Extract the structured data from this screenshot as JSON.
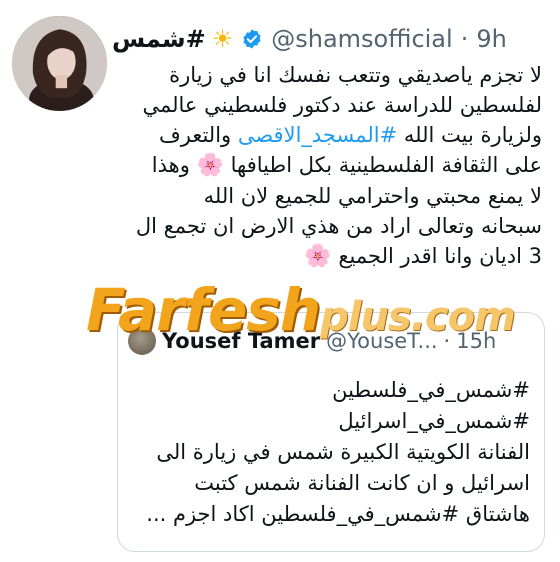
{
  "tweet": {
    "display_name": "#شمس",
    "name_emoji": "☀",
    "handle": "@shamsofficial",
    "separator": "·",
    "time": "9h",
    "lines": [
      "لا تجزم ياصديقي وتتعب نفسك انا في زيارة",
      "لفلسطين للدراسة عند دكتور فلسطيني عالمي",
      {
        "pre": "ولزيارة بيت الله ",
        "hashtag": "#المسجد_الاقصى",
        "post": " والتعرف"
      },
      {
        "pre": "على الثقافة الفلسطينية  بكل اطيافها ",
        "flower": "🌸",
        "post": " وهذا"
      },
      "لا يمنع محبتي واحترامي للجميع  لان الله",
      "سبحانه وتعالى اراد من هذي الارض ان تجمع ال",
      {
        "pre": "3 اديان وانا اقدر الجميع ",
        "flower": "🌸",
        "post": ""
      }
    ],
    "flower_color": "#e85d92",
    "link_color": "#1d9bf0"
  },
  "watermark": {
    "main": "Farfesh",
    "suffix": "plus.com",
    "color": "#f2a41c"
  },
  "quote": {
    "name": "Yousef Tamer",
    "handle": "@YouseT...",
    "separator": "·",
    "time": "15h",
    "lines": [
      "#شمس_في_فلسطين",
      "#شمس_في_اسرائيل",
      "الفنانة الكويتية الكبيرة شمس في زيارة الى",
      "اسرائيل و ان كانت الفنانة شمس كتبت",
      "هاشتاق #شمس_في_فلسطين اكاد اجزم ..."
    ]
  }
}
